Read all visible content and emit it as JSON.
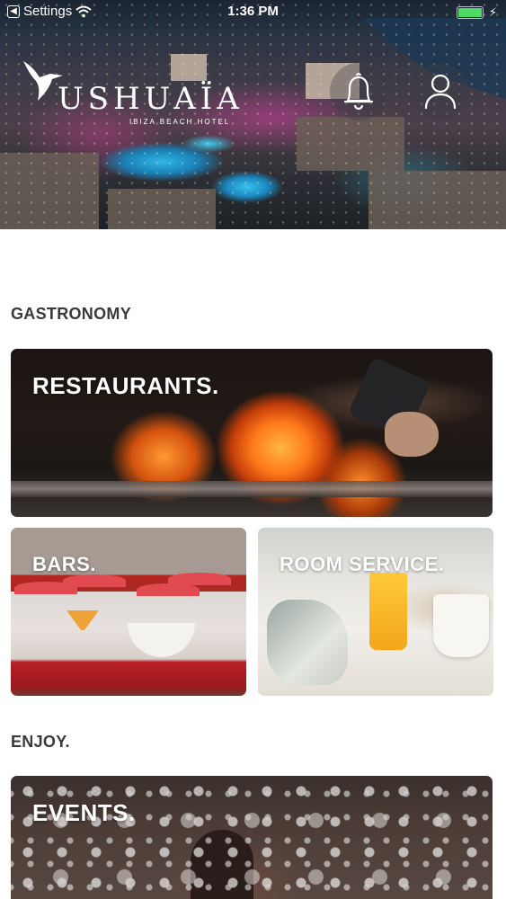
{
  "status_bar": {
    "back_app": "Settings",
    "time": "1:36 PM",
    "battery_color": "#4cd964"
  },
  "header": {
    "logo_icon": "hummingbird-icon",
    "logo_text": "USHUAÏA",
    "logo_subtext": "IBIZA BEACH HOTEL",
    "notifications_icon": "bell-icon",
    "profile_icon": "user-icon"
  },
  "sections": {
    "gastronomy": {
      "title": "GASTRONOMY",
      "cards": {
        "restaurants": "RESTAURANTS.",
        "bars": "BARS.",
        "room_service": "ROOM SERVICE."
      }
    },
    "enjoy": {
      "title": "ENJOY.",
      "cards": {
        "events": "EVENTS."
      }
    }
  }
}
